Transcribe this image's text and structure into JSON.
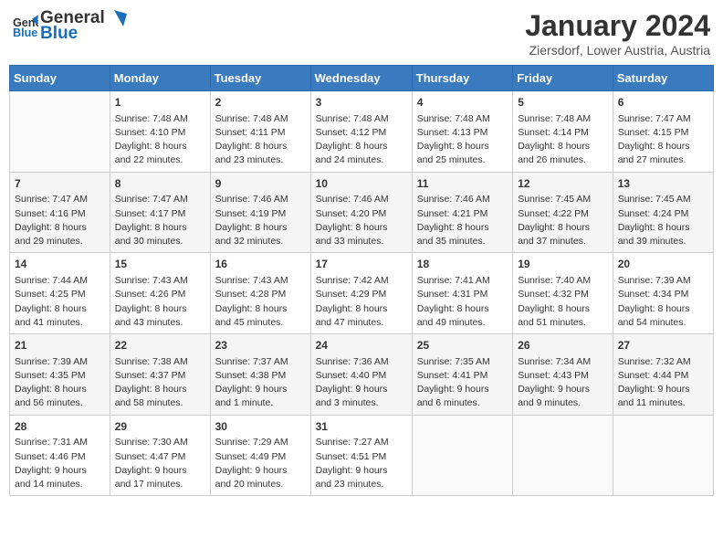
{
  "header": {
    "logo_general": "General",
    "logo_blue": "Blue",
    "month": "January 2024",
    "location": "Ziersdorf, Lower Austria, Austria"
  },
  "weekdays": [
    "Sunday",
    "Monday",
    "Tuesday",
    "Wednesday",
    "Thursday",
    "Friday",
    "Saturday"
  ],
  "weeks": [
    [
      {
        "day": "",
        "info": ""
      },
      {
        "day": "1",
        "info": "Sunrise: 7:48 AM\nSunset: 4:10 PM\nDaylight: 8 hours\nand 22 minutes."
      },
      {
        "day": "2",
        "info": "Sunrise: 7:48 AM\nSunset: 4:11 PM\nDaylight: 8 hours\nand 23 minutes."
      },
      {
        "day": "3",
        "info": "Sunrise: 7:48 AM\nSunset: 4:12 PM\nDaylight: 8 hours\nand 24 minutes."
      },
      {
        "day": "4",
        "info": "Sunrise: 7:48 AM\nSunset: 4:13 PM\nDaylight: 8 hours\nand 25 minutes."
      },
      {
        "day": "5",
        "info": "Sunrise: 7:48 AM\nSunset: 4:14 PM\nDaylight: 8 hours\nand 26 minutes."
      },
      {
        "day": "6",
        "info": "Sunrise: 7:47 AM\nSunset: 4:15 PM\nDaylight: 8 hours\nand 27 minutes."
      }
    ],
    [
      {
        "day": "7",
        "info": "Sunrise: 7:47 AM\nSunset: 4:16 PM\nDaylight: 8 hours\nand 29 minutes."
      },
      {
        "day": "8",
        "info": "Sunrise: 7:47 AM\nSunset: 4:17 PM\nDaylight: 8 hours\nand 30 minutes."
      },
      {
        "day": "9",
        "info": "Sunrise: 7:46 AM\nSunset: 4:19 PM\nDaylight: 8 hours\nand 32 minutes."
      },
      {
        "day": "10",
        "info": "Sunrise: 7:46 AM\nSunset: 4:20 PM\nDaylight: 8 hours\nand 33 minutes."
      },
      {
        "day": "11",
        "info": "Sunrise: 7:46 AM\nSunset: 4:21 PM\nDaylight: 8 hours\nand 35 minutes."
      },
      {
        "day": "12",
        "info": "Sunrise: 7:45 AM\nSunset: 4:22 PM\nDaylight: 8 hours\nand 37 minutes."
      },
      {
        "day": "13",
        "info": "Sunrise: 7:45 AM\nSunset: 4:24 PM\nDaylight: 8 hours\nand 39 minutes."
      }
    ],
    [
      {
        "day": "14",
        "info": "Sunrise: 7:44 AM\nSunset: 4:25 PM\nDaylight: 8 hours\nand 41 minutes."
      },
      {
        "day": "15",
        "info": "Sunrise: 7:43 AM\nSunset: 4:26 PM\nDaylight: 8 hours\nand 43 minutes."
      },
      {
        "day": "16",
        "info": "Sunrise: 7:43 AM\nSunset: 4:28 PM\nDaylight: 8 hours\nand 45 minutes."
      },
      {
        "day": "17",
        "info": "Sunrise: 7:42 AM\nSunset: 4:29 PM\nDaylight: 8 hours\nand 47 minutes."
      },
      {
        "day": "18",
        "info": "Sunrise: 7:41 AM\nSunset: 4:31 PM\nDaylight: 8 hours\nand 49 minutes."
      },
      {
        "day": "19",
        "info": "Sunrise: 7:40 AM\nSunset: 4:32 PM\nDaylight: 8 hours\nand 51 minutes."
      },
      {
        "day": "20",
        "info": "Sunrise: 7:39 AM\nSunset: 4:34 PM\nDaylight: 8 hours\nand 54 minutes."
      }
    ],
    [
      {
        "day": "21",
        "info": "Sunrise: 7:39 AM\nSunset: 4:35 PM\nDaylight: 8 hours\nand 56 minutes."
      },
      {
        "day": "22",
        "info": "Sunrise: 7:38 AM\nSunset: 4:37 PM\nDaylight: 8 hours\nand 58 minutes."
      },
      {
        "day": "23",
        "info": "Sunrise: 7:37 AM\nSunset: 4:38 PM\nDaylight: 9 hours\nand 1 minute."
      },
      {
        "day": "24",
        "info": "Sunrise: 7:36 AM\nSunset: 4:40 PM\nDaylight: 9 hours\nand 3 minutes."
      },
      {
        "day": "25",
        "info": "Sunrise: 7:35 AM\nSunset: 4:41 PM\nDaylight: 9 hours\nand 6 minutes."
      },
      {
        "day": "26",
        "info": "Sunrise: 7:34 AM\nSunset: 4:43 PM\nDaylight: 9 hours\nand 9 minutes."
      },
      {
        "day": "27",
        "info": "Sunrise: 7:32 AM\nSunset: 4:44 PM\nDaylight: 9 hours\nand 11 minutes."
      }
    ],
    [
      {
        "day": "28",
        "info": "Sunrise: 7:31 AM\nSunset: 4:46 PM\nDaylight: 9 hours\nand 14 minutes."
      },
      {
        "day": "29",
        "info": "Sunrise: 7:30 AM\nSunset: 4:47 PM\nDaylight: 9 hours\nand 17 minutes."
      },
      {
        "day": "30",
        "info": "Sunrise: 7:29 AM\nSunset: 4:49 PM\nDaylight: 9 hours\nand 20 minutes."
      },
      {
        "day": "31",
        "info": "Sunrise: 7:27 AM\nSunset: 4:51 PM\nDaylight: 9 hours\nand 23 minutes."
      },
      {
        "day": "",
        "info": ""
      },
      {
        "day": "",
        "info": ""
      },
      {
        "day": "",
        "info": ""
      }
    ]
  ]
}
